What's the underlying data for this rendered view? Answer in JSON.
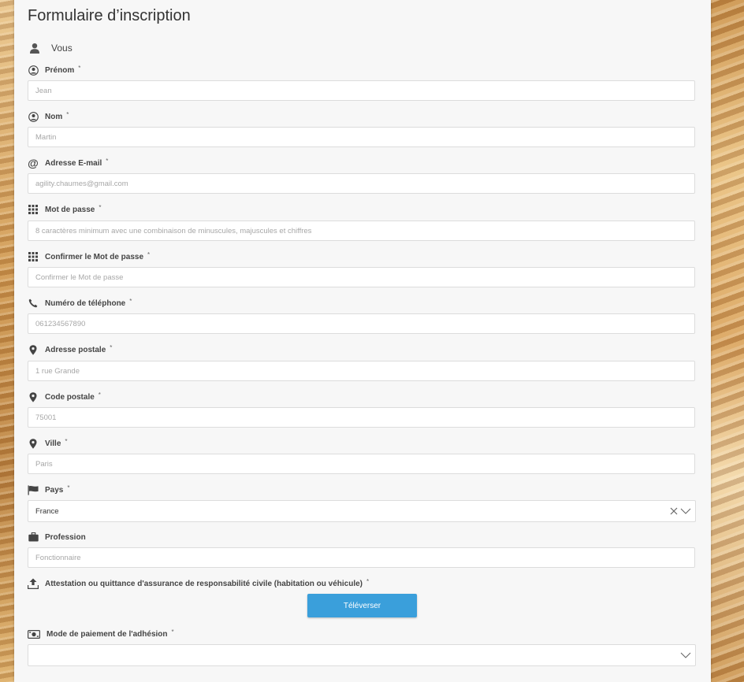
{
  "form": {
    "title": "Formulaire d’inscription",
    "section_label": "Vous",
    "required_mark": "*",
    "fields": {
      "prenom": {
        "label": "Prénom",
        "placeholder": "Jean",
        "icon": "user-circle-icon"
      },
      "nom": {
        "label": "Nom",
        "placeholder": "Martin",
        "icon": "user-circle-icon"
      },
      "email": {
        "label": "Adresse E-mail",
        "placeholder": "agility.chaumes@gmail.com",
        "icon": "at-icon"
      },
      "password": {
        "label": "Mot de passe",
        "placeholder": "8 caractères minimum avec une combinaison de minuscules, majuscules et chiffres",
        "icon": "keypad-icon"
      },
      "password_confirm": {
        "label": "Confirmer le Mot de passe",
        "placeholder": "Confirmer le Mot de passe",
        "icon": "keypad-icon"
      },
      "phone": {
        "label": "Numéro de téléphone",
        "placeholder": "061234567890",
        "icon": "phone-icon"
      },
      "address": {
        "label": "Adresse postale",
        "placeholder": "1 rue Grande",
        "icon": "map-pin-icon"
      },
      "postal_code": {
        "label": "Code postale",
        "placeholder": "75001",
        "icon": "map-pin-icon"
      },
      "city": {
        "label": "Ville",
        "placeholder": "Paris",
        "icon": "map-pin-icon"
      },
      "country": {
        "label": "Pays",
        "value": "France",
        "icon": "flag-icon"
      },
      "profession": {
        "label": "Profession",
        "placeholder": "Fonctionnaire",
        "icon": "briefcase-icon"
      },
      "insurance": {
        "label": "Attestation ou quittance d'assurance de responsabilité civile (habitation ou véhicule)",
        "button_label": "Téléverser",
        "icon": "upload-icon"
      },
      "payment": {
        "label": "Mode de paiement de l'adhésion",
        "value": "",
        "icon": "banknote-icon"
      }
    }
  },
  "colors": {
    "panel_bg": "#f7f7f7",
    "upload_button": "#3a9fdb",
    "input_border": "#dcdcdc"
  }
}
